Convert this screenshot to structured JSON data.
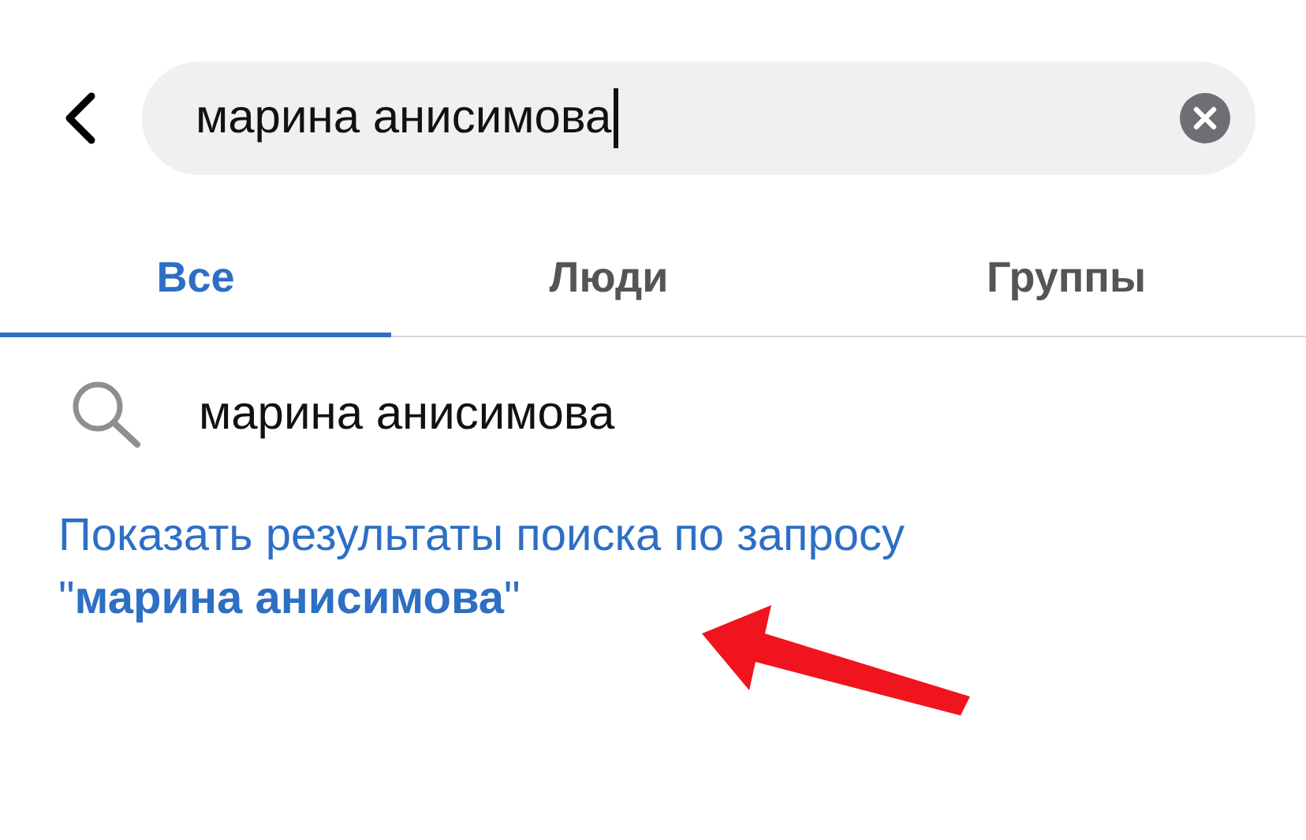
{
  "search_field": {
    "value": "марина анисимова",
    "focused": true
  },
  "tabs": [
    {
      "label": "Все",
      "selected": true
    },
    {
      "label": "Люди",
      "selected": false
    },
    {
      "label": "Группы",
      "selected": false
    }
  ],
  "suggestions": [
    {
      "text": "марина анисимова"
    }
  ],
  "show_results_link": "Показать результаты поиска по запросу\n\"**марина анисимова**\""
}
